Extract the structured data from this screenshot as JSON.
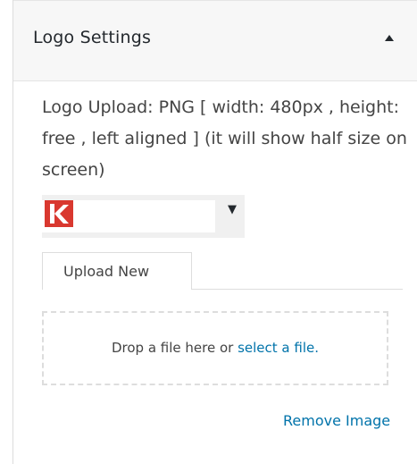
{
  "panel": {
    "title": "Logo Settings",
    "collapse_icon": "triangle-up-icon"
  },
  "logo_upload": {
    "description": "Logo Upload: PNG [ width: 480px , height: free , left aligned ] (it will show half size on screen)",
    "selected_logo_icon": "k-logo",
    "dropdown_icon": "caret-down-icon"
  },
  "tabs": [
    {
      "label": "Upload New"
    }
  ],
  "dropzone": {
    "text_before": "Drop a file here or",
    "link_label": "select a file",
    "text_after": "."
  },
  "actions": {
    "remove_label": "Remove Image"
  },
  "colors": {
    "link": "#0073aa",
    "logo_red": "#d9382f",
    "header_bg": "#f7f7f7"
  }
}
